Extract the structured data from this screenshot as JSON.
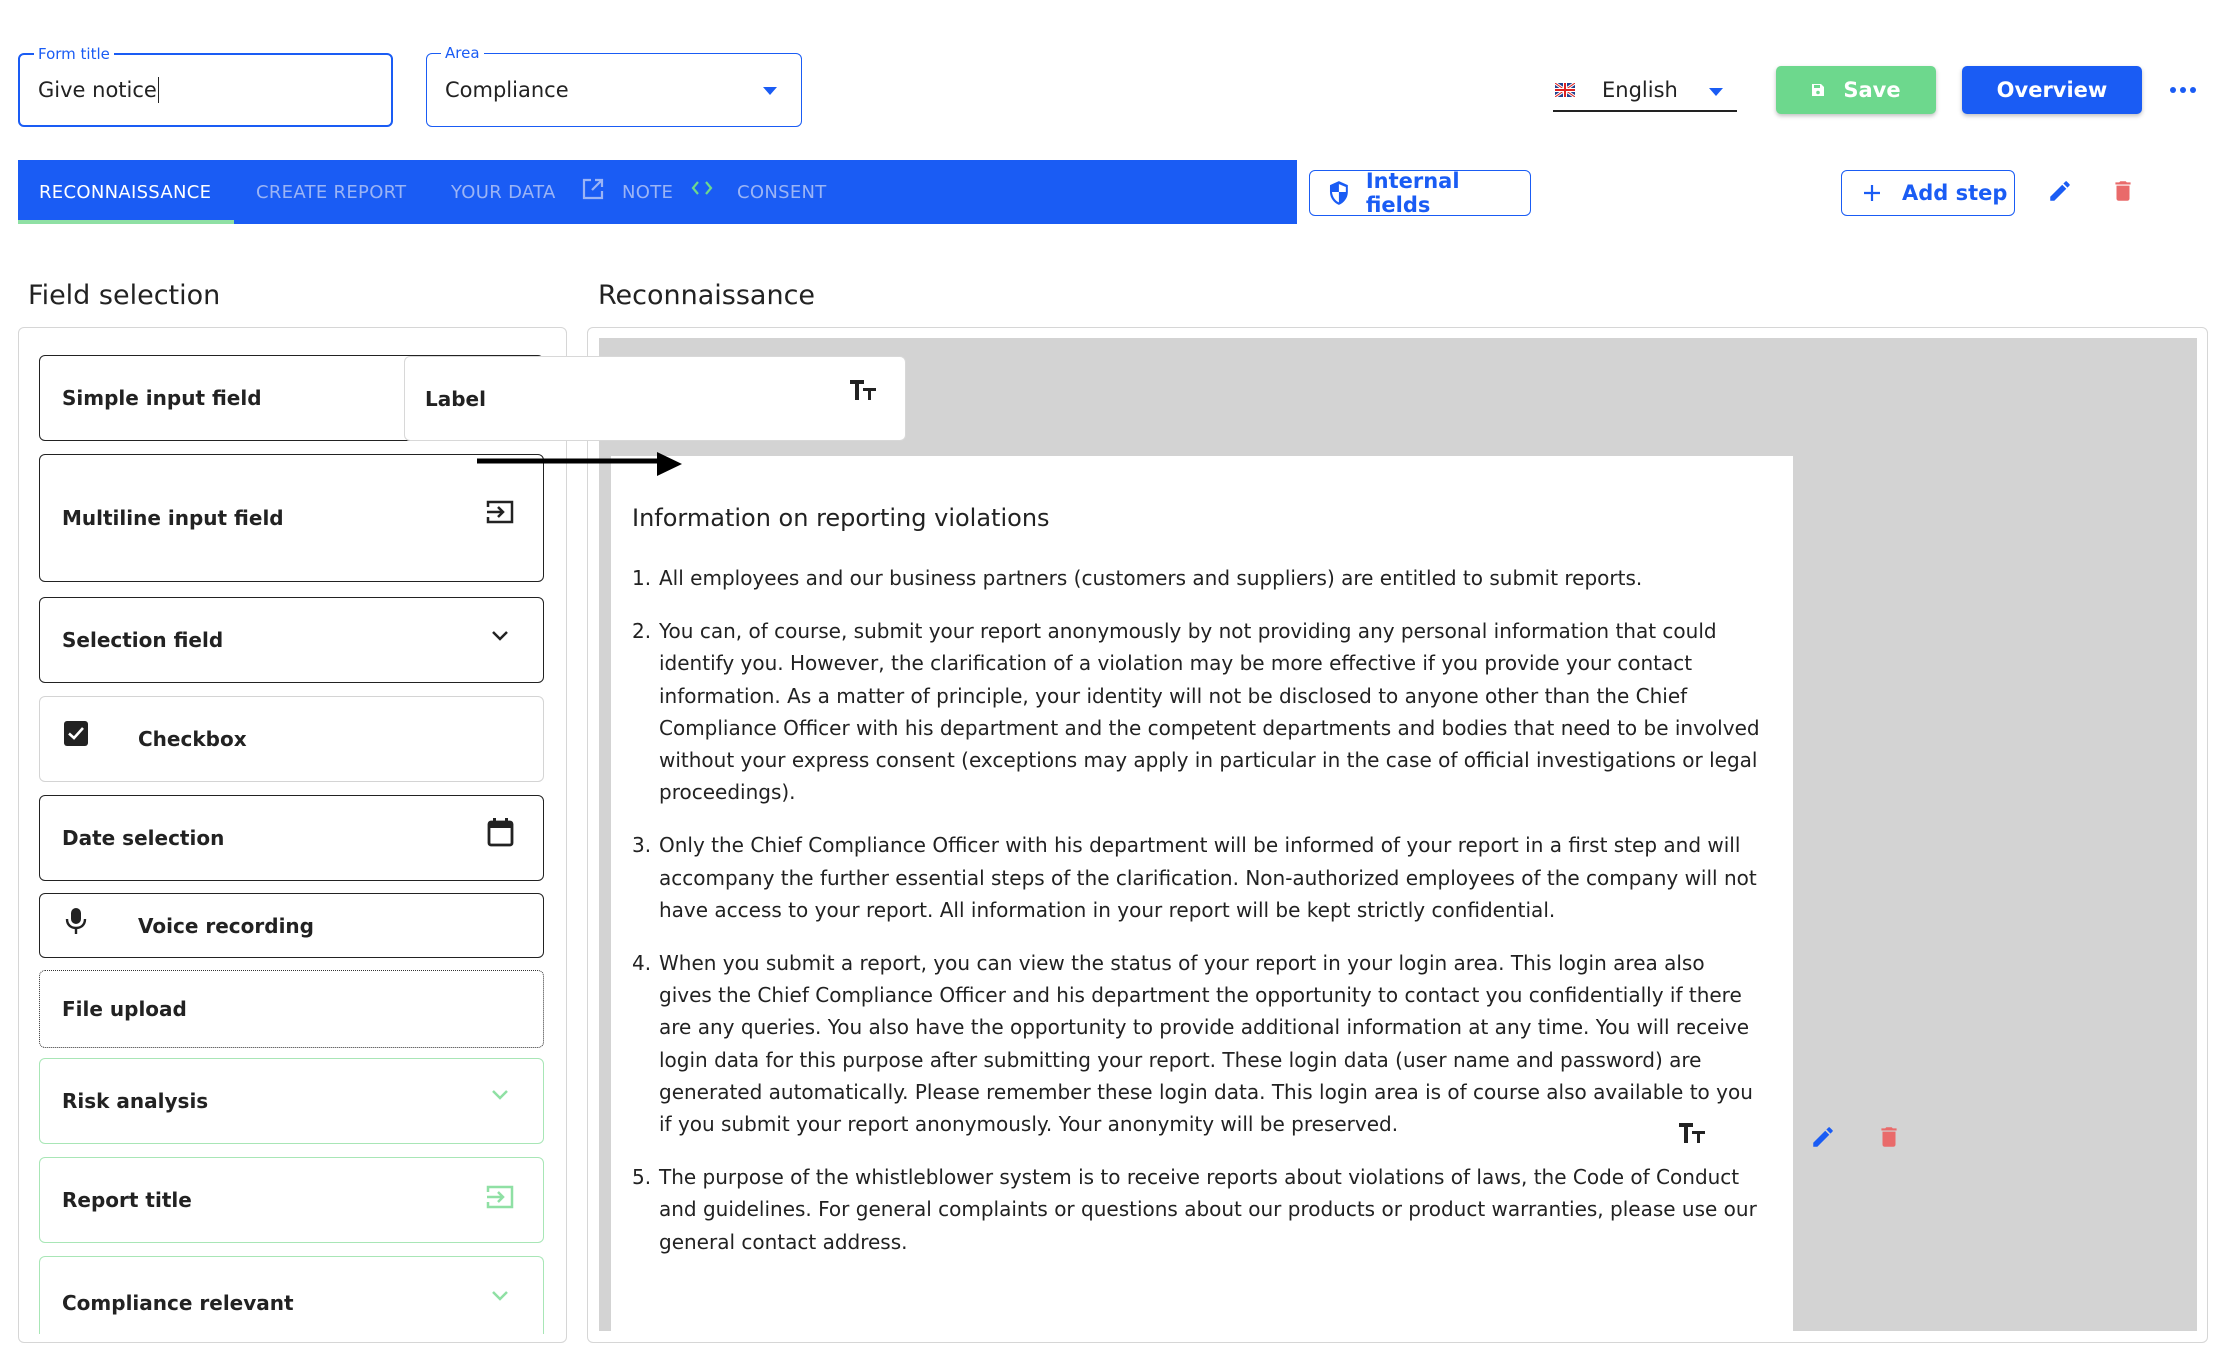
{
  "header": {
    "form_title": {
      "legend": "Form title",
      "value": "Give notice"
    },
    "area": {
      "legend": "Area",
      "value": "Compliance"
    },
    "language": {
      "flag_icon": "uk-flag-icon",
      "value": "English"
    },
    "save_label": "Save",
    "overview_label": "Overview",
    "more_icon": "more-horizontal-icon"
  },
  "tabs": [
    {
      "label": "RECONNAISSANCE",
      "active": true
    },
    {
      "label": "CREATE REPORT",
      "active": false
    },
    {
      "label": "YOUR DATA",
      "active": false
    },
    {
      "label": "NOTE",
      "active": false
    },
    {
      "label": "CONSENT",
      "active": false
    }
  ],
  "tab_icons": [
    "open-in-new-icon",
    "code-brackets-icon"
  ],
  "toolbar": {
    "internal_fields_label": "Internal fields",
    "add_step_label": "Add step"
  },
  "field_selection": {
    "title": "Field selection",
    "items": [
      {
        "label": "Simple input field",
        "icon": ""
      },
      {
        "label": "Multiline input field",
        "icon": "input-arrow-icon"
      },
      {
        "label": "Selection field",
        "icon": "chevron-down-icon"
      },
      {
        "label": "Checkbox",
        "icon": "checkbox-checked-icon"
      },
      {
        "label": "Date selection",
        "icon": "calendar-icon"
      },
      {
        "label": "Voice recording",
        "icon": "microphone-icon"
      },
      {
        "label": "File upload",
        "icon": ""
      },
      {
        "label": "Risk analysis",
        "icon": "chevron-down-icon"
      },
      {
        "label": "Report title",
        "icon": "input-arrow-icon"
      },
      {
        "label": "Compliance relevant",
        "icon": "chevron-down-icon"
      }
    ]
  },
  "drag_ghost": {
    "label": "Label",
    "icon": "text-size-icon"
  },
  "step": {
    "title": "Reconnaissance",
    "content_heading": "Information on reporting violations",
    "paragraphs": [
      {
        "num": "1.",
        "text": "All employees and our business partners (customers and suppliers) are entitled to submit reports."
      },
      {
        "num": "2.",
        "text": "You can, of course, submit your report anonymously by not providing any personal information that could identify you. However, the clarification of a violation may be more effective if you provide your contact information. As a matter of principle, your identity will not be disclosed to anyone other than the Chief Compliance Officer with his department and the competent departments and bodies that need to be involved without your express consent (exceptions may apply in particular in the case of official investigations or legal proceedings)."
      },
      {
        "num": "3.",
        "text": "Only the Chief Compliance Officer with his department will be informed of your report in a first step and will accompany the further essential steps of the clarification. Non-authorized employees of the company will not have access to your report. All information in your report will be kept strictly confidential."
      },
      {
        "num": "4.",
        "text": "When you submit a report, you can view the status of your report in your login area. This login area also gives the Chief Compliance Officer and his department the opportunity to contact you confidentially if there are any queries. You also have the opportunity to provide additional information at any time. You will receive login data for this purpose after submitting your report. These login data (user name and password) are generated automatically. Please remember these login data. This login area is of course also available to you if you submit your report anonymously. Your anonymity will be preserved."
      },
      {
        "num": "5.",
        "text": "The purpose of the whistleblower system is to receive reports about violations of laws, the Code of Conduct and guidelines. For general complaints or questions about our products or product warranties, please use our general contact address."
      }
    ]
  },
  "colors": {
    "primary": "#1a5cf4",
    "save_green": "#6dd88d",
    "delete_red": "#e96a6a",
    "tab_indicator": "#8fe0a4",
    "canvas_gray": "#d3d3d3"
  }
}
